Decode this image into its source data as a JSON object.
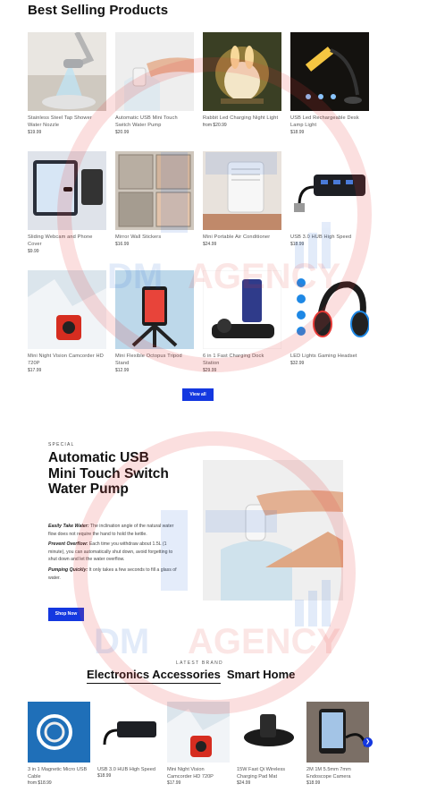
{
  "best_selling": {
    "title": "Best Selling Products",
    "products": [
      {
        "name": "Stainless Steel Tap Shower Water Nozzle",
        "price": "$19.99"
      },
      {
        "name": "Automatic USB Mini Touch Switch Water Pump",
        "price": "$20.99"
      },
      {
        "name": "Rabbit Led Charging Night Light",
        "price": "from $20.99"
      },
      {
        "name": "USB Led Rechargeable Desk Lamp Light",
        "price": "$18.99"
      },
      {
        "name": "Sliding Webcam and Phone Cover",
        "price": "$9.99"
      },
      {
        "name": "Mirror Wall Stickers",
        "price": "$16.99"
      },
      {
        "name": "Mini Portable Air Conditioner",
        "price": "$24.99"
      },
      {
        "name": "USB 3.0 HUB High Speed",
        "price": "$18.99"
      },
      {
        "name": "Mini Night Vision Camcorder HD 720P",
        "price": "$17.99"
      },
      {
        "name": "Mini Flexible Octopus Tripod Stand",
        "price": "$12.99"
      },
      {
        "name": "6 in 1 Fast Charging Dock Station",
        "price": "$29.99"
      },
      {
        "name": "LED Lights Gaming Headset",
        "price": "$32.99"
      }
    ],
    "view_all": "View all"
  },
  "feature": {
    "eyebrow": "SPECIAL",
    "title": "Automatic USB Mini Touch Switch Water Pump",
    "points": [
      {
        "label": "Easily Take Water:",
        "text": " The inclination angle of the natural water flow does not require the hand to hold the kettle."
      },
      {
        "label": "Prevent Overflow:",
        "text": " Each time you withdraw about 1.5L (1 minute), you can automatically shut down, avoid forgetting to shut down and let the water overflow."
      },
      {
        "label": "Pumping Quickly:",
        "text": " It only takes a few seconds to fill a glass of water."
      }
    ],
    "cta": "Shop Now"
  },
  "brand": {
    "eyebrow": "LATEST BRAND",
    "tabs": [
      "Electronics Accessories",
      "Smart Home"
    ],
    "active_tab": 0,
    "products": [
      {
        "name": "3 in 1 Magnetic Micro USB Cable",
        "price": "from $18.99"
      },
      {
        "name": "USB 3.0 HUB High Speed",
        "price": "$18.99"
      },
      {
        "name": "Mini Night Vision Camcorder HD 720P",
        "price": "$17.99"
      },
      {
        "name": "15W Fast Qi Wireless Charging Pad Mat",
        "price": "$24.99"
      },
      {
        "name": "2M 1M 5.5mm 7mm Endoscope Camera",
        "price": "$18.99"
      }
    ],
    "next_icon": "chevron-right-icon"
  },
  "watermark": {
    "brand": "DM",
    "word": "AGENCY",
    "color": "#e53935",
    "accent": "#1e63d6"
  },
  "colors": {
    "accent": "#1438e0"
  }
}
